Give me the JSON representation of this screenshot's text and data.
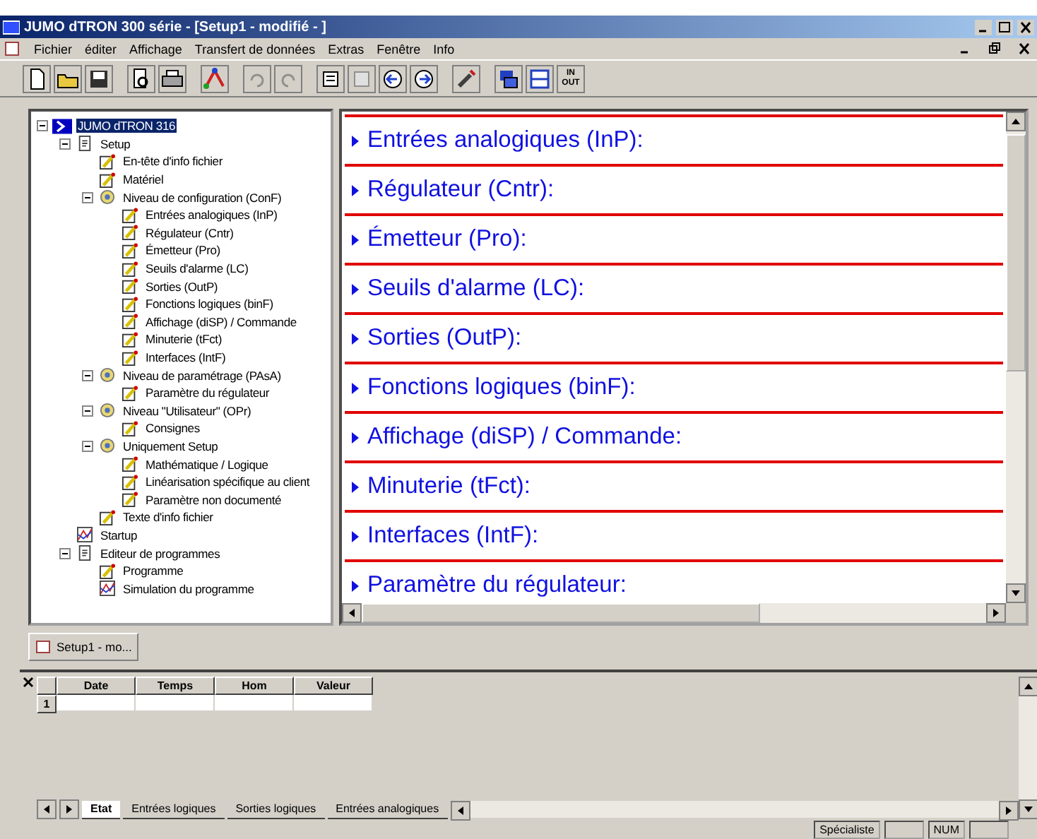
{
  "window": {
    "title": "JUMO dTRON 300 série - [Setup1 - modifié - ]"
  },
  "menu": [
    "Fichier",
    "éditer",
    "Affichage",
    "Transfert de données",
    "Extras",
    "Fenêtre",
    "Info"
  ],
  "toolbar": {
    "in_out_label": [
      "IN",
      "OUT"
    ]
  },
  "tree": [
    {
      "label": "JUMO dTRON 316",
      "kind": "device",
      "selected": true,
      "expanded": true,
      "children": [
        {
          "label": "Setup",
          "kind": "doc",
          "selected": false,
          "expanded": true,
          "children": [
            {
              "label": "En-tête d'info fichier",
              "kind": "check",
              "selected": false
            },
            {
              "label": "Matériel",
              "kind": "check",
              "selected": false
            },
            {
              "label": "Niveau de configuration (ConF)",
              "kind": "level",
              "selected": false,
              "expanded": true,
              "children": [
                {
                  "label": "Entrées analogiques (InP)",
                  "kind": "check",
                  "selected": false
                },
                {
                  "label": "Régulateur (Cntr)",
                  "kind": "check",
                  "selected": false
                },
                {
                  "label": "Émetteur (Pro)",
                  "kind": "check",
                  "selected": false
                },
                {
                  "label": "Seuils d'alarme (LC)",
                  "kind": "check",
                  "selected": false
                },
                {
                  "label": "Sorties (OutP)",
                  "kind": "check",
                  "selected": false
                },
                {
                  "label": "Fonctions logiques (binF)",
                  "kind": "check",
                  "selected": false
                },
                {
                  "label": "Affichage (diSP) / Commande",
                  "kind": "check",
                  "selected": false
                },
                {
                  "label": "Minuterie (tFct)",
                  "kind": "check",
                  "selected": false
                },
                {
                  "label": "Interfaces (IntF)",
                  "kind": "check",
                  "selected": false
                }
              ]
            },
            {
              "label": "Niveau de paramétrage (PAsA)",
              "kind": "level",
              "selected": false,
              "expanded": true,
              "children": [
                {
                  "label": "Paramètre du régulateur",
                  "kind": "check",
                  "selected": false
                }
              ]
            },
            {
              "label": "Niveau \"Utilisateur\" (OPr)",
              "kind": "level",
              "selected": false,
              "expanded": true,
              "children": [
                {
                  "label": "Consignes",
                  "kind": "check",
                  "selected": false
                }
              ]
            },
            {
              "label": "Uniquement Setup",
              "kind": "level",
              "selected": false,
              "expanded": true,
              "children": [
                {
                  "label": "Mathématique / Logique",
                  "kind": "check",
                  "selected": false
                },
                {
                  "label": "Linéarisation spécifique au client",
                  "kind": "check",
                  "selected": false
                },
                {
                  "label": "Paramètre non documenté",
                  "kind": "check",
                  "selected": false
                }
              ]
            },
            {
              "label": "Texte d'info fichier",
              "kind": "check",
              "selected": false
            }
          ]
        },
        {
          "label": "Startup",
          "kind": "chart",
          "selected": false
        },
        {
          "label": "Editeur de programmes",
          "kind": "doc",
          "selected": false,
          "expanded": true,
          "children": [
            {
              "label": "Programme",
              "kind": "check",
              "selected": false
            },
            {
              "label": "Simulation du programme",
              "kind": "chart",
              "selected": false
            }
          ]
        }
      ]
    }
  ],
  "sections": [
    "Entrées analogiques (InP):",
    "Régulateur (Cntr):",
    "Émetteur (Pro):",
    "Seuils d'alarme (LC):",
    "Sorties (OutP):",
    "Fonctions logiques (binF):",
    "Affichage (diSP) / Commande:",
    "Minuterie (tFct):",
    "Interfaces (IntF):",
    "Paramètre du régulateur:"
  ],
  "document_tabs": [
    {
      "label": "Setup1 - mo...",
      "selected": true
    }
  ],
  "table": {
    "columns": [
      "Date",
      "Temps",
      "Hom",
      "Valeur"
    ],
    "rows": [
      "1"
    ]
  },
  "sheet_tabs": [
    {
      "label": "Etat",
      "selected": true
    },
    {
      "label": "Entrées logiques",
      "selected": false
    },
    {
      "label": "Sorties logiques",
      "selected": false
    },
    {
      "label": "Entrées analogiques",
      "selected": false
    }
  ],
  "status_bar": [
    "Spécialiste",
    "NUM"
  ]
}
